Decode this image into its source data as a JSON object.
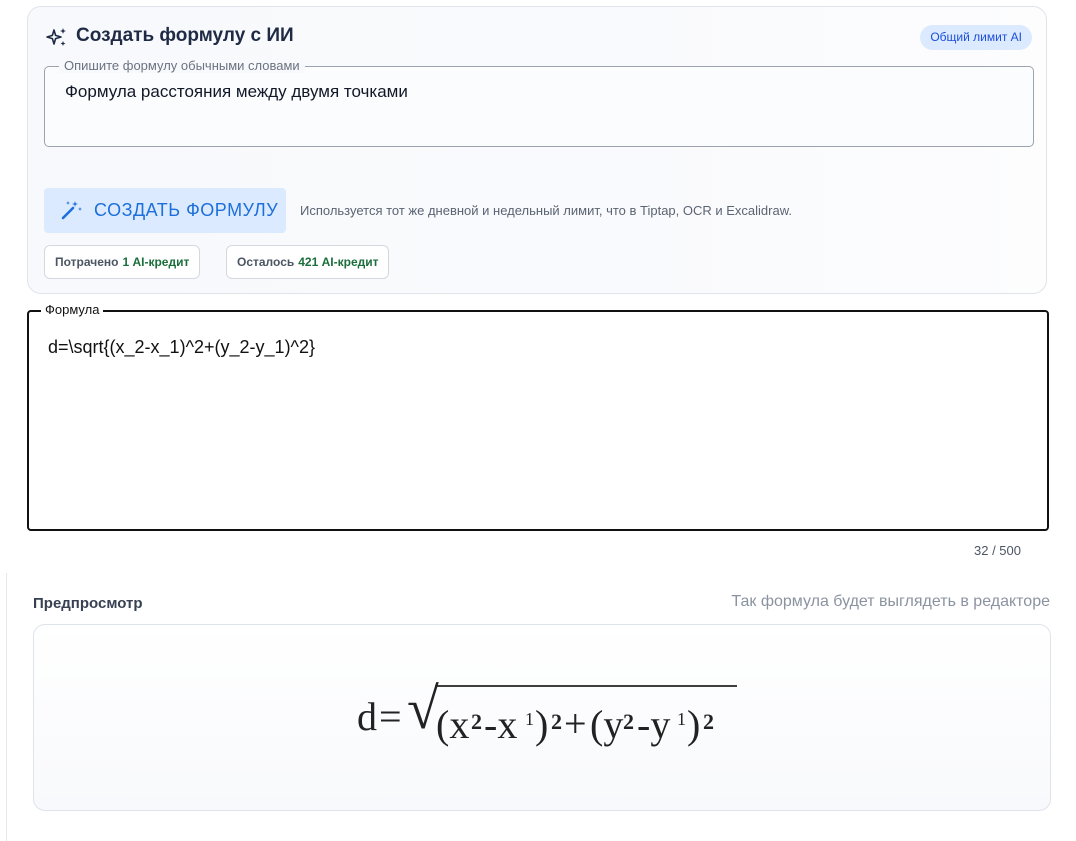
{
  "ai_panel": {
    "title": "Создать формулу с ИИ",
    "header_icon": "sparkles-icon",
    "limit_badge": "Общий лимит AI",
    "prompt": {
      "legend": "Опишите формулу обычными словами",
      "value": "Формула расстояния между двумя точками"
    },
    "generate_button": {
      "icon": "magic-wand-icon",
      "label": "СОЗДАТЬ ФОРМУЛУ"
    },
    "limit_note": "Используется тот же дневной и недельный лимит, что в Tiptap, OCR и Excalidraw.",
    "spent": {
      "label": "Потрачено",
      "value": "1 AI-кредит"
    },
    "remaining": {
      "label": "Осталось",
      "value": "421 AI-кредит"
    }
  },
  "formula": {
    "legend": "Формула",
    "value": "d=\\sqrt{(x_2-x_1)^2+(y_2-y_1)^2}",
    "char_count": "32 / 500"
  },
  "preview": {
    "label": "Предпросмотр",
    "hint": "Так формула будет выглядеть в редакторе",
    "render": {
      "lhs": "d",
      "eq": "=",
      "radical": "√",
      "g1": "(x",
      "s1": "2",
      "g2": "-x",
      "s2": "1",
      "g3": ")",
      "s3": "2",
      "plus": "+",
      "g4": "(y",
      "s4": "2",
      "g5": "-y",
      "s5": "1",
      "g6": ")",
      "s6": "2"
    }
  },
  "colors": {
    "accent": "#1d6fdb",
    "badge_bg": "#dbeafe",
    "credit_green": "#1b6e3b"
  }
}
